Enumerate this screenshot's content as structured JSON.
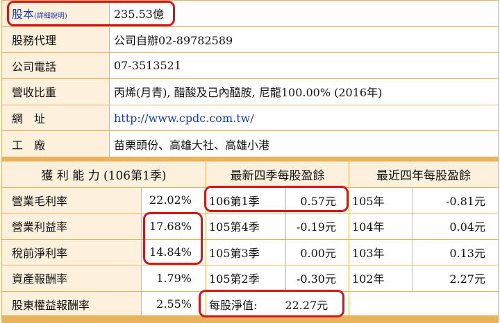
{
  "top_rows": [
    {
      "label": "股本",
      "sublabel": "(詳細說明)",
      "value": "235.53億"
    },
    {
      "label": "股務代理",
      "value": "公司自辦02-89782589"
    },
    {
      "label": "公司電話",
      "value": "07-3513521"
    },
    {
      "label": "營收比重",
      "value": "丙烯(月青), 醋酸及己內醯胺, 尼龍100.00% (2016年)"
    },
    {
      "label": "網　址",
      "value": "http://www.cpdc.com.tw/"
    },
    {
      "label": "工　廠",
      "value": "苗栗頭份、高雄大社、高雄小港"
    }
  ],
  "headers": {
    "profit": "獲 利 能 力 (106第1季)",
    "eps4q": "最新四季每股盈餘",
    "eps4y": "最近四年每股盈餘"
  },
  "profit_rows": [
    {
      "label": "營業毛利率",
      "value": "22.02%"
    },
    {
      "label": "營業利益率",
      "value": "17.68%"
    },
    {
      "label": "稅前淨利率",
      "value": "14.84%"
    },
    {
      "label": "資產報酬率",
      "value": "1.79%"
    },
    {
      "label": "股東權益報酬率",
      "value": "2.55%"
    }
  ],
  "quarter_rows": [
    {
      "period": "106第1季",
      "value": "0.57元"
    },
    {
      "period": "105第4季",
      "value": "-0.19元"
    },
    {
      "period": "105第3季",
      "value": "0.00元"
    },
    {
      "period": "105第2季",
      "value": "-0.30元"
    }
  ],
  "year_rows": [
    {
      "year": "105年",
      "value": "-0.81元"
    },
    {
      "year": "104年",
      "value": "0.04元"
    },
    {
      "year": "103年",
      "value": "0.13元"
    },
    {
      "year": "102年",
      "value": "2.27元"
    }
  ],
  "nav": {
    "label": "每股淨值:",
    "value": "22.27元"
  },
  "colors": {
    "border": "#e8b35a",
    "label_bg": "#fdf0dc",
    "highlight": "#d6151b"
  }
}
